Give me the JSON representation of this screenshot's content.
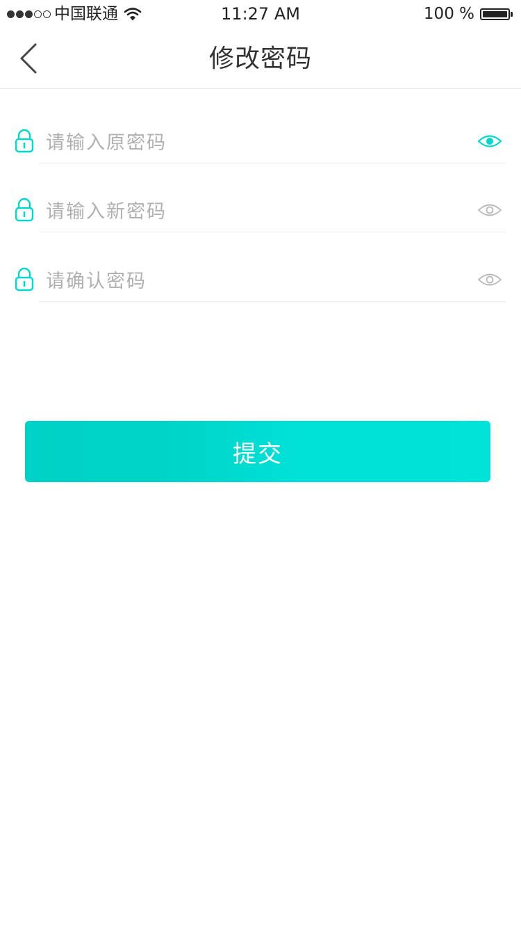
{
  "status_bar": {
    "carrier": "中国联通",
    "time": "11:27 AM",
    "battery": "100 %",
    "icons": [
      "signal-dots-icon",
      "wifi-icon",
      "battery-icon"
    ]
  },
  "nav": {
    "title": "修改密码",
    "back_icon": "chevron-left-icon"
  },
  "form": {
    "fields": [
      {
        "placeholder": "请输入原密码",
        "value": "",
        "lock_icon": "lock-icon",
        "eye_icon": "eye-icon",
        "eye_active": true
      },
      {
        "placeholder": "请输入新密码",
        "value": "",
        "lock_icon": "lock-icon",
        "eye_icon": "eye-icon",
        "eye_active": false
      },
      {
        "placeholder": "请确认密码",
        "value": "",
        "lock_icon": "lock-icon",
        "eye_icon": "eye-icon",
        "eye_active": false
      }
    ]
  },
  "submit": {
    "label": "提交"
  },
  "colors": {
    "accent": "#00d8cd",
    "accent_start": "#00d1c6",
    "accent_end": "#00e3d9",
    "icon_inactive": "#b8b8b8",
    "text": "#333333",
    "placeholder": "#b0b0b0",
    "divider": "#eeeeee"
  }
}
